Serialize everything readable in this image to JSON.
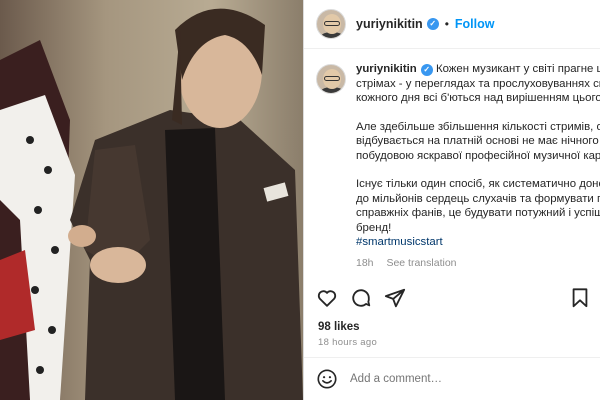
{
  "post": {
    "username": "yuriynikitin",
    "follow_label": "Follow",
    "dot": "•",
    "verified_glyph": "✓",
    "caption_lines_1": [
      "Кожен музикант у світі прагне шви",
      "стрімах - у переглядах та прослуховуваннях своїх",
      "кожного дня всі б'ються над вирішенням цього п"
    ],
    "caption_lines_2": [
      "Але здебільше збільшення кількості стримів, особ",
      "відбувається на платній основі не має нічного спі",
      "побудовою яскравої професійної музичної кар'єр"
    ],
    "caption_lines_3": [
      "Існує тільки один спосіб, як систематично донос",
      "до мільйонів сердець слухачів та формувати пот",
      "справжніх фанів, це будувати потужний і успішни",
      "бренд!"
    ],
    "hashtag": "#smartmusicstart",
    "time_short": "18h",
    "see_translation": "See translation",
    "likes": "98 likes",
    "time_ago": "18 hours ago",
    "comment_placeholder": "Add a comment…"
  },
  "icons": {
    "verified": "verified-badge-icon",
    "like": "heart-icon",
    "comment": "comment-icon",
    "share": "share-icon",
    "save": "bookmark-icon",
    "emoji": "emoji-icon"
  },
  "colors": {
    "link": "#0095f6",
    "verified": "#3897f0",
    "muted": "#8e8e8e",
    "hashtag": "#00376b"
  }
}
